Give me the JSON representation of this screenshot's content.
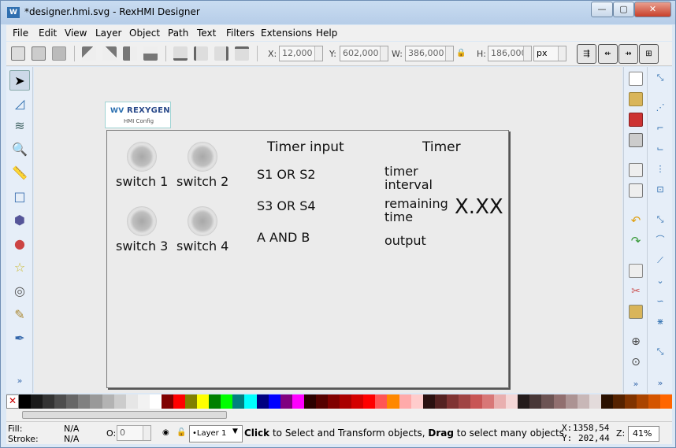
{
  "window": {
    "title": "*designer.hmi.svg - RexHMI Designer",
    "app_icon_text": "W",
    "minimize_glyph": "—",
    "maximize_glyph": "▢",
    "close_glyph": "✕"
  },
  "menu": [
    "File",
    "Edit",
    "View",
    "Layer",
    "Object",
    "Path",
    "Text",
    "Filters",
    "Extensions",
    "Help"
  ],
  "toolbar": {
    "x_label": "X:",
    "x_value": "12,000",
    "y_label": "Y:",
    "y_value": "602,000",
    "w_label": "W:",
    "w_value": "386,000",
    "h_label": "H:",
    "h_value": "186,000",
    "unit": "px",
    "lock_glyph": "🔒"
  },
  "logo": {
    "brand": "REXYGEN",
    "subtitle": "HMI Config"
  },
  "canvas": {
    "switch_labels": [
      "switch 1",
      "switch 2",
      "switch 3",
      "switch 4"
    ],
    "timer_input_title": "Timer input",
    "timer_input_rows": [
      "S1 OR S2",
      "S3 OR S4",
      "A AND B"
    ],
    "timer_title": "Timer",
    "timer_interval_l1": "timer",
    "timer_interval_l2": "interval",
    "remaining_l1": "remaining",
    "remaining_l2": "time",
    "output_label": "output",
    "display_value": "X.XX"
  },
  "tools_more": "»",
  "status": {
    "fill_label": "Fill:",
    "fill_value": "N/A",
    "stroke_label": "Stroke:",
    "stroke_value": "N/A",
    "opacity_label": "O:",
    "opacity_value": "0",
    "layer": "•Layer 1",
    "msg_click": "Click",
    "msg_mid": " to Select and Transform objects, ",
    "msg_drag": "Drag",
    "msg_end": " to select many objects.",
    "x_label": "X:",
    "x_value": "1358,54",
    "y_label": "Y:",
    "y_value": "202,44",
    "zoom_label": "Z:",
    "zoom_value": "41%"
  },
  "colors": {
    "accent": "#2f6fb0",
    "canvas_bg": "#ebebeb",
    "window_frame": "#dce8f5"
  }
}
